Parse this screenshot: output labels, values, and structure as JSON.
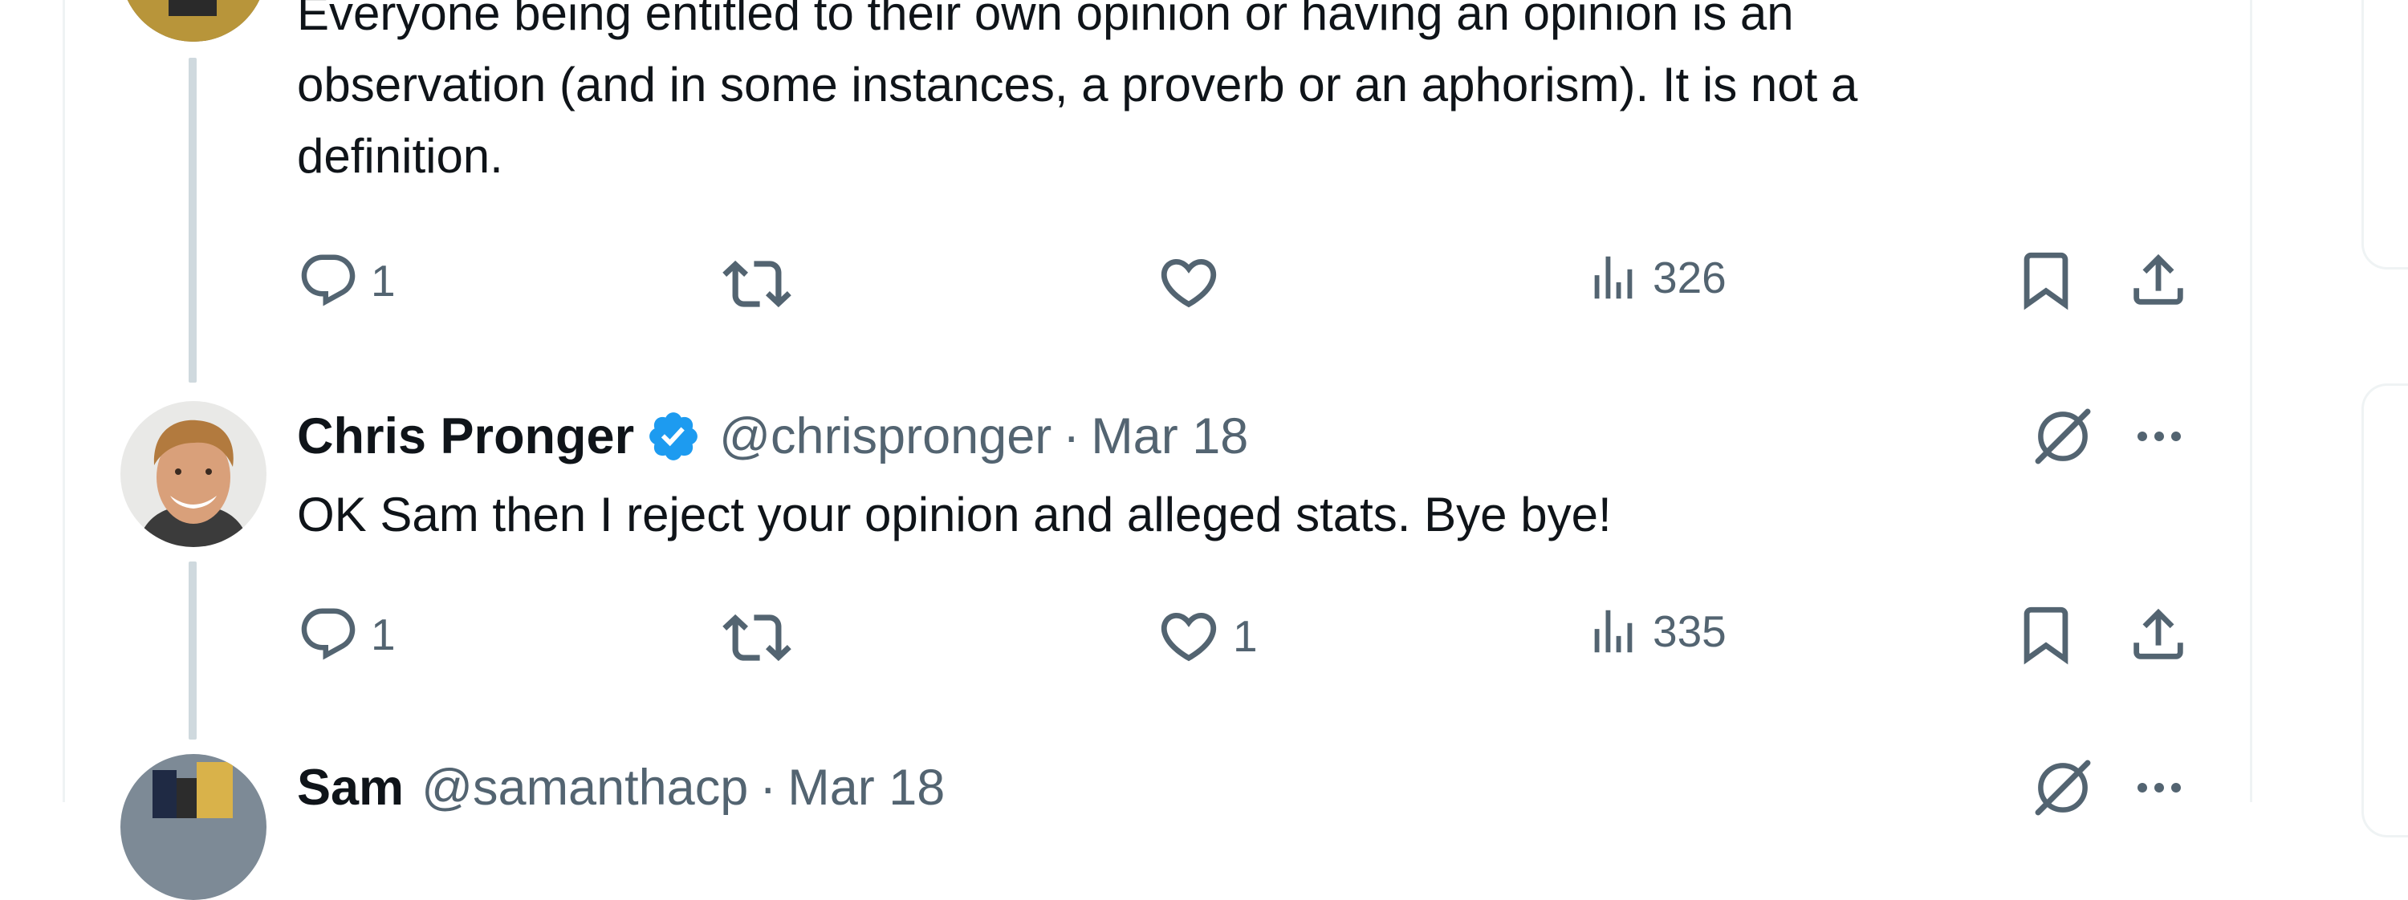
{
  "tweets": [
    {
      "text_lines": [
        "Everyone being entitled to their own opinion or having an opinion is an",
        "observation (and in some instances, a proverb or an aphorism). It is not a",
        "definition."
      ],
      "actions": {
        "reply_count": "1",
        "retweet_count": "",
        "like_count": "",
        "view_count": "326"
      }
    },
    {
      "author": {
        "name": "Chris Pronger",
        "handle": "@chrispronger",
        "verified": true
      },
      "separator": "·",
      "date": "Mar 18",
      "text_lines": [
        "OK Sam then I reject your opinion and alleged stats. Bye bye!"
      ],
      "actions": {
        "reply_count": "1",
        "retweet_count": "",
        "like_count": "1",
        "view_count": "335"
      }
    },
    {
      "author": {
        "name": "Sam",
        "handle": "@samanthacp"
      },
      "separator": "·",
      "date": "Mar 18"
    }
  ],
  "colors": {
    "text": "#0f1419",
    "muted": "#536471",
    "verified": "#1d9bf0",
    "thread_line": "#cfd9de",
    "border": "#eff3f4"
  },
  "icons": [
    "reply-icon",
    "retweet-icon",
    "like-icon",
    "views-icon",
    "bookmark-icon",
    "share-icon",
    "grok-icon",
    "more-icon",
    "verified-badge-icon"
  ]
}
